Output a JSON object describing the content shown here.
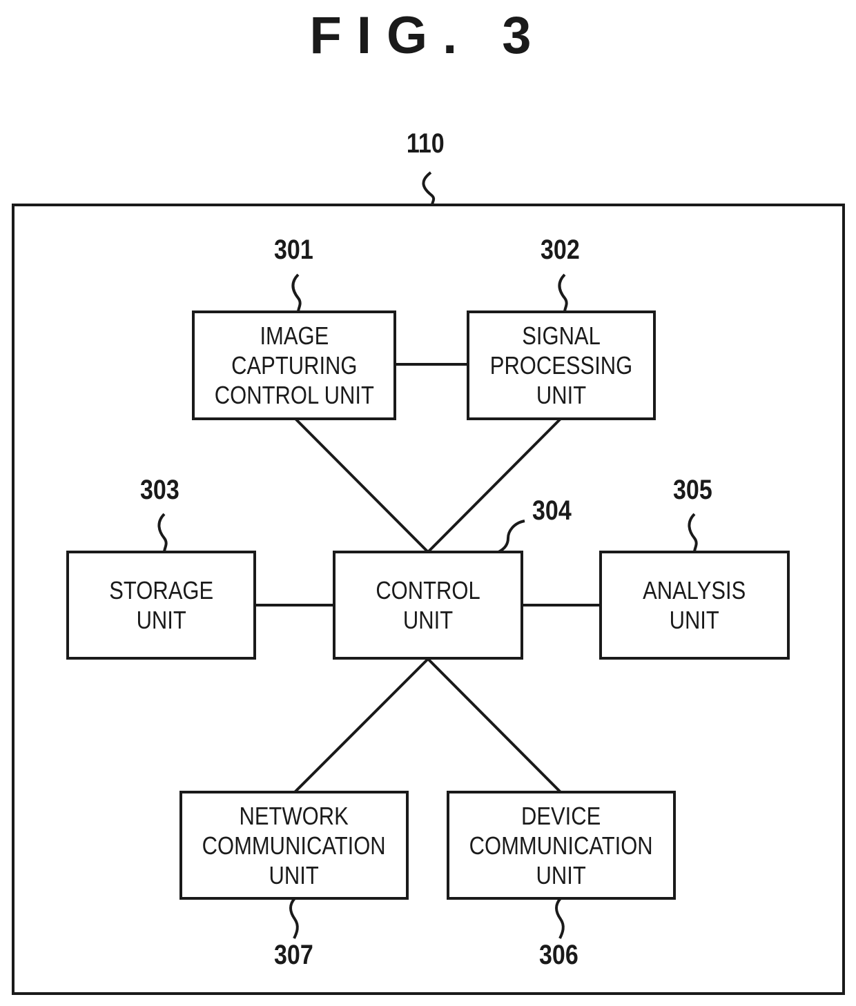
{
  "figure": {
    "title": "FIG. 3",
    "device_ref": "110"
  },
  "blocks": [
    {
      "id": "301",
      "label": "IMAGE\nCAPTURING\nCONTROL UNIT"
    },
    {
      "id": "302",
      "label": "SIGNAL\nPROCESSING\nUNIT"
    },
    {
      "id": "303",
      "label": "STORAGE\nUNIT"
    },
    {
      "id": "304",
      "label": "CONTROL\nUNIT"
    },
    {
      "id": "305",
      "label": "ANALYSIS\nUNIT"
    },
    {
      "id": "306",
      "label": "DEVICE\nCOMMUNICATION\nUNIT"
    },
    {
      "id": "307",
      "label": "NETWORK\nCOMMUNICATION\nUNIT"
    }
  ],
  "connections": [
    [
      "301",
      "302"
    ],
    [
      "301",
      "304"
    ],
    [
      "302",
      "304"
    ],
    [
      "303",
      "304"
    ],
    [
      "304",
      "305"
    ],
    [
      "304",
      "307"
    ],
    [
      "304",
      "306"
    ]
  ]
}
